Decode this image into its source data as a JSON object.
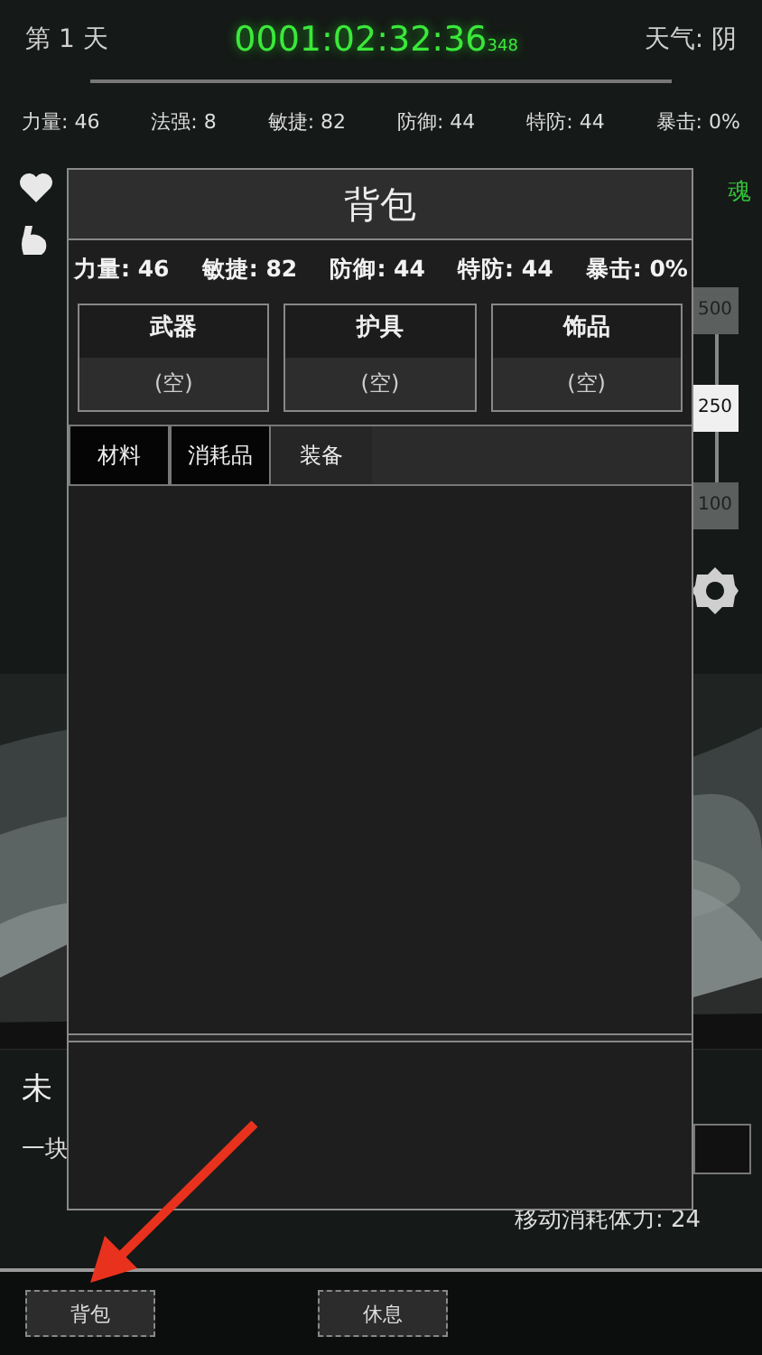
{
  "top_bar": {
    "day": "第 1 天",
    "timer": "0001:02:32:36",
    "timer_ms": "348",
    "weather": "天气: 阴"
  },
  "stats": [
    "力量: 46",
    "法强: 8",
    "敏捷: 82",
    "防御: 44",
    "特防: 44",
    "暴击: 0%"
  ],
  "soul_label": "魂",
  "zoom_buttons": [
    {
      "label": "500",
      "selected": false
    },
    {
      "label": "250",
      "selected": true
    },
    {
      "label": "100",
      "selected": false
    }
  ],
  "location": {
    "name": "未",
    "description": "一块"
  },
  "move_cost": "移动消耗体力: 24",
  "bottom_buttons": [
    "背包",
    "休息"
  ],
  "backpack": {
    "title": "背包",
    "stats": [
      "力量: 46",
      "敏捷: 82",
      "防御: 44",
      "特防: 44",
      "暴击: 0%"
    ],
    "slots": [
      {
        "name": "武器",
        "value": "(空)"
      },
      {
        "name": "护具",
        "value": "(空)"
      },
      {
        "name": "饰品",
        "value": "(空)"
      }
    ],
    "tabs": [
      {
        "label": "材料",
        "selected": false
      },
      {
        "label": "消耗品",
        "selected": false
      },
      {
        "label": "装备",
        "selected": true
      }
    ]
  }
}
